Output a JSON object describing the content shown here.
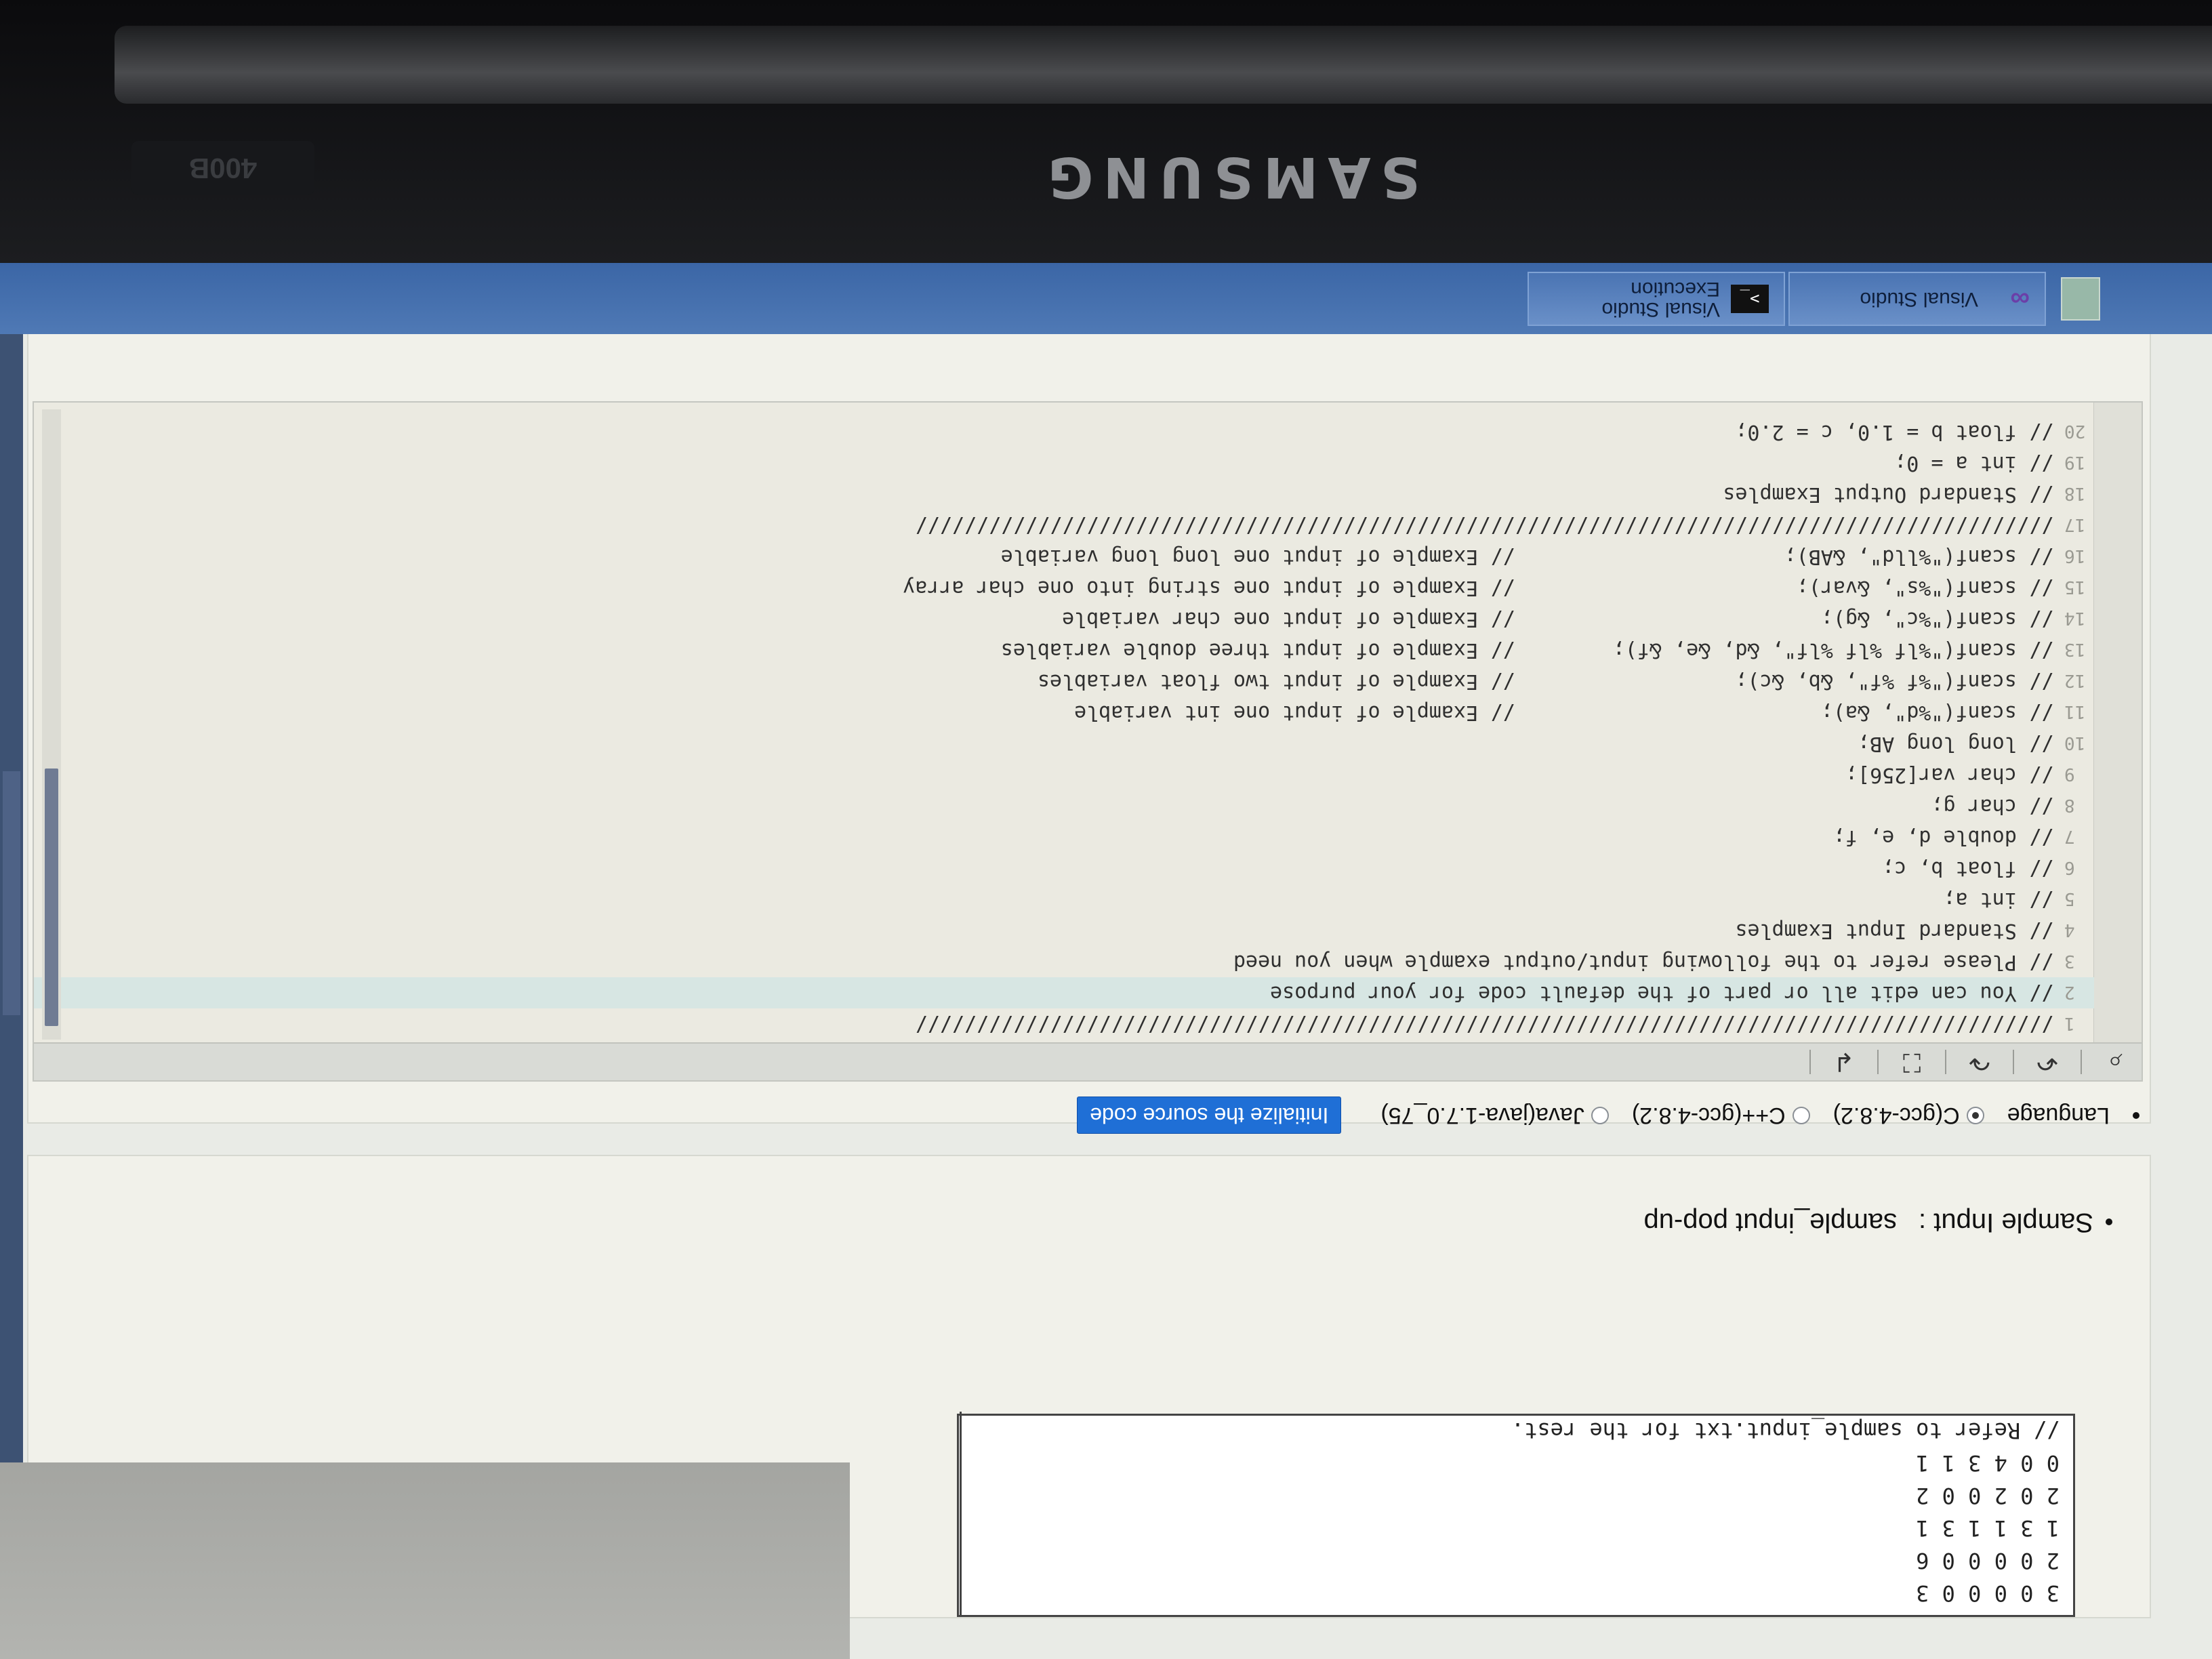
{
  "device": {
    "brand": "SAMSUNG",
    "sticker": "400B"
  },
  "taskbar": {
    "items": [
      {
        "label": "Visual Studio",
        "icon": "visual-studio-icon"
      },
      {
        "label": "Visual Studio",
        "sublabel": "Execution",
        "icon": "terminal-icon"
      }
    ]
  },
  "sample_input": {
    "title": "Sample Input :",
    "value": "sample_input pop-up",
    "lines": [
      "3 0 0 0 0 3",
      "2 0 0 0 0 6",
      "1 3 1 1 3 1",
      "2 0 2 0 0 2",
      "0 0 4 3 1 1",
      "// Refer to sample_input.txt for the rest."
    ]
  },
  "language": {
    "label": "Language",
    "options": [
      {
        "label": "C(gcc-4.8.2)",
        "selected": true
      },
      {
        "label": "C++(gcc-4.8.2)",
        "selected": false
      },
      {
        "label": "Java(java-1.7.0_75)",
        "selected": false
      }
    ],
    "init_button": "Initialize the source code"
  },
  "toolbar": {
    "icons": [
      "search-icon",
      "undo-icon",
      "redo-icon",
      "fullscreen-icon",
      "wrap-icon"
    ],
    "glyphs": [
      "⌕",
      "↶",
      "↷",
      "⛶",
      "↲"
    ]
  },
  "code": {
    "lines": [
      {
        "n": "1",
        "text": "/////////////////////////////////////////////////////////////////////////////////////////////"
      },
      {
        "n": "2",
        "text": "// You can edit all or part of the default code for your purpose"
      },
      {
        "n": "3",
        "text": "// Please refer to the following input/output example when you need"
      },
      {
        "n": "4",
        "text": "// Standard Input Examples"
      },
      {
        "n": "5",
        "text": "// int a;"
      },
      {
        "n": "6",
        "text": "// float b, c;"
      },
      {
        "n": "7",
        "text": "// double d, e, f;"
      },
      {
        "n": "8",
        "text": "// char g;"
      },
      {
        "n": "9",
        "text": "// char var[256];"
      },
      {
        "n": "10",
        "text": "// long long AB;"
      },
      {
        "n": "11",
        "text": "// scanf(\"%d\", &a);                         // Example of input one int variable"
      },
      {
        "n": "12",
        "text": "// scanf(\"%f %f\", &b, &c);                  // Example of input two float variables"
      },
      {
        "n": "13",
        "text": "// scanf(\"%lf %lf %lf\", &d, &e, &f);        // Example of input three double variables"
      },
      {
        "n": "14",
        "text": "// scanf(\"%c\", &g);                         // Example of input one char variable"
      },
      {
        "n": "15",
        "text": "// scanf(\"%s\", &var);                       // Example of input one string into one char array"
      },
      {
        "n": "16",
        "text": "// scanf(\"%lld\", &AB);                      // Example of input one long long variable"
      },
      {
        "n": "17",
        "text": "/////////////////////////////////////////////////////////////////////////////////////////////"
      },
      {
        "n": "18",
        "text": "// Standard Output Examples"
      },
      {
        "n": "19",
        "text": "// int a = 0;"
      },
      {
        "n": "20",
        "text": "// float b = 1.0, c = 2.0;"
      }
    ]
  },
  "colors": {
    "init_button": "#1f6fd6",
    "taskbar": "#3b66a6",
    "highlight_line": "#d7e6e3"
  }
}
